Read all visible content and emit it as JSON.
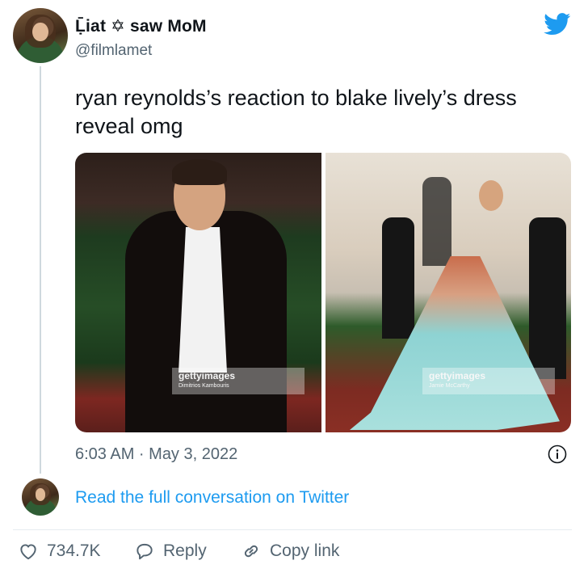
{
  "author": {
    "display_name": "Ḹiat ✡ saw MoM",
    "handle": "@filmlamet"
  },
  "tweet": {
    "text": "ryan reynolds’s reaction to blake lively’s dress reveal omg",
    "timestamp": "6:03 AM · May 3, 2022",
    "photos": [
      {
        "watermark": "gettyimages",
        "credit": "Dimitrios Kambouris"
      },
      {
        "watermark": "gettyimages",
        "credit": "Jamie McCarthy"
      }
    ]
  },
  "read_full": "Read the full conversation on Twitter",
  "actions": {
    "like_count": "734.7K",
    "reply_label": "Reply",
    "copy_label": "Copy link"
  },
  "colors": {
    "accent": "#1d9bf0",
    "muted": "#536471",
    "text": "#0f1419"
  },
  "icons": [
    "twitter-bird-icon",
    "info-icon",
    "heart-icon",
    "reply-bubble-icon",
    "link-icon"
  ]
}
